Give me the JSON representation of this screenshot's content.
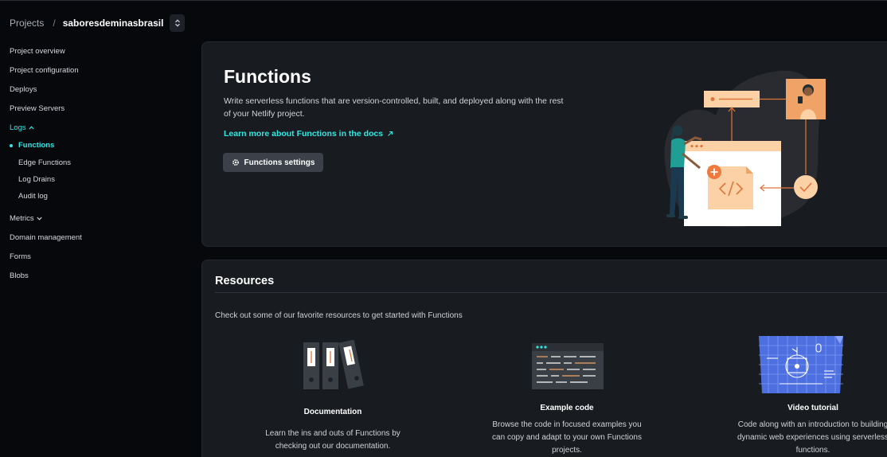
{
  "breadcrumb": {
    "projects": "Projects",
    "separator": "/",
    "site": "saboresdeminasbrasil",
    "switcher_icon": "chevron-up-down-icon"
  },
  "sidebar": {
    "items": [
      {
        "label": "Project overview"
      },
      {
        "label": "Project configuration"
      },
      {
        "label": "Deploys"
      },
      {
        "label": "Preview Servers"
      },
      {
        "label": "Logs",
        "expanded": true
      },
      {
        "label": "Functions",
        "active": true
      },
      {
        "label": "Edge Functions"
      },
      {
        "label": "Log Drains"
      },
      {
        "label": "Audit log"
      },
      {
        "label": "Metrics",
        "expanded": false
      },
      {
        "label": "Domain management"
      },
      {
        "label": "Forms"
      },
      {
        "label": "Blobs"
      }
    ]
  },
  "functions": {
    "title": "Functions",
    "description": "Write serverless functions that are version-controlled, built, and deployed along with the rest of your Netlify project.",
    "docs_link": "Learn more about Functions in the docs",
    "settings_button": "Functions settings"
  },
  "resources": {
    "title": "Resources",
    "intro": "Check out some of our favorite resources to get started with Functions",
    "items": [
      {
        "name": "Documentation",
        "text": "Learn the ins and outs of Functions by checking out our documentation.",
        "icon": "binders-icon"
      },
      {
        "name": "Example code",
        "text": "Browse the code in focused examples you can copy and adapt to your own Functions projects.",
        "icon": "code-window-icon"
      },
      {
        "name": "Video tutorial",
        "text": "Code along with an introduction to building dynamic web experiences using serverless functions.",
        "icon": "blueprint-icon"
      }
    ]
  },
  "colors": {
    "accent": "#32e6e2",
    "illustration_orange": "#f0a366",
    "illustration_peach": "#fcd1a5",
    "background": "#06080c",
    "card": "#181b20"
  }
}
